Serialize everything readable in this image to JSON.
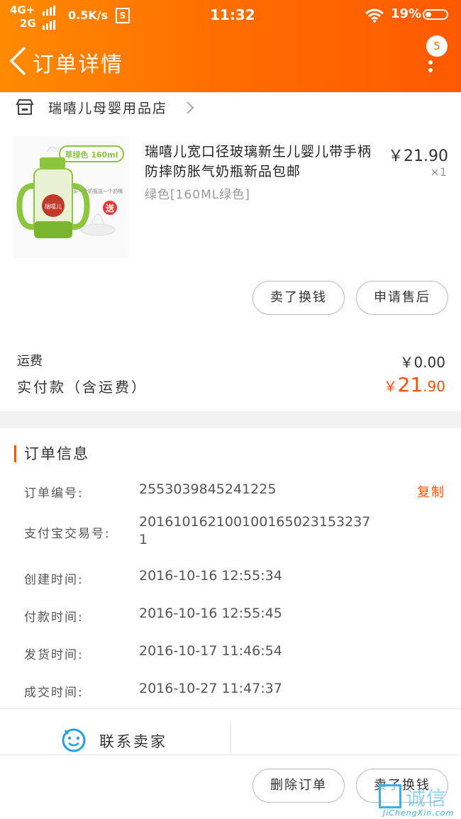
{
  "status_bar": {
    "network_top": "4G+",
    "network_bottom": "2G",
    "speed": "0.5K/s",
    "s_badge": "S",
    "time": "11:32",
    "battery": "19%"
  },
  "nav": {
    "title": "订单详情",
    "badge_count": "5"
  },
  "shop": {
    "name": "瑞嘻儿母婴用品店"
  },
  "product": {
    "title": "瑞嘻儿宽口径玻璃新生儿婴儿带手柄防摔防胀气奶瓶新品包邮",
    "spec": "绿色[160ML绿色]",
    "price": "￥21.90",
    "qty": "×1",
    "image_tag": "草绿色 160ml",
    "image_gift": "送",
    "image_brand": "瑞嘻儿",
    "image_caption": "买一个奶瓶送一个奶嘴"
  },
  "actions": {
    "sell": "卖了换钱",
    "after_sale": "申请售后"
  },
  "summary": {
    "shipping_label": "运费",
    "shipping_value": "￥0.00",
    "paid_label": "实付款（含运费）",
    "paid_currency": "￥",
    "paid_int": "21",
    "paid_dec": ".90"
  },
  "order_info": {
    "title": "订单信息",
    "copy_label": "复制",
    "rows": [
      {
        "k": "订单编号:",
        "v": "2553039845241225"
      },
      {
        "k": "支付宝交易号:",
        "v": "20161016210010016502315323​7"
      },
      {
        "k": "创建时间:",
        "v": "2016-10-16 12:55:34"
      },
      {
        "k": "付款时间:",
        "v": "2016-10-16 12:55:45"
      },
      {
        "k": "发货时间:",
        "v": "2016-10-17 11:46:54"
      },
      {
        "k": "成交时间:",
        "v": "2016-10-27 11:47:37"
      }
    ]
  },
  "alipay_line2": "1",
  "contact": {
    "label": "联系卖家"
  },
  "bottom": {
    "delete": "删除订单",
    "sell": "卖了换钱"
  },
  "watermark": {
    "cn": "诚信",
    "en": "JiChengXin.com"
  },
  "colors": {
    "header": "#ff6a00",
    "accent": "#ff5000"
  }
}
